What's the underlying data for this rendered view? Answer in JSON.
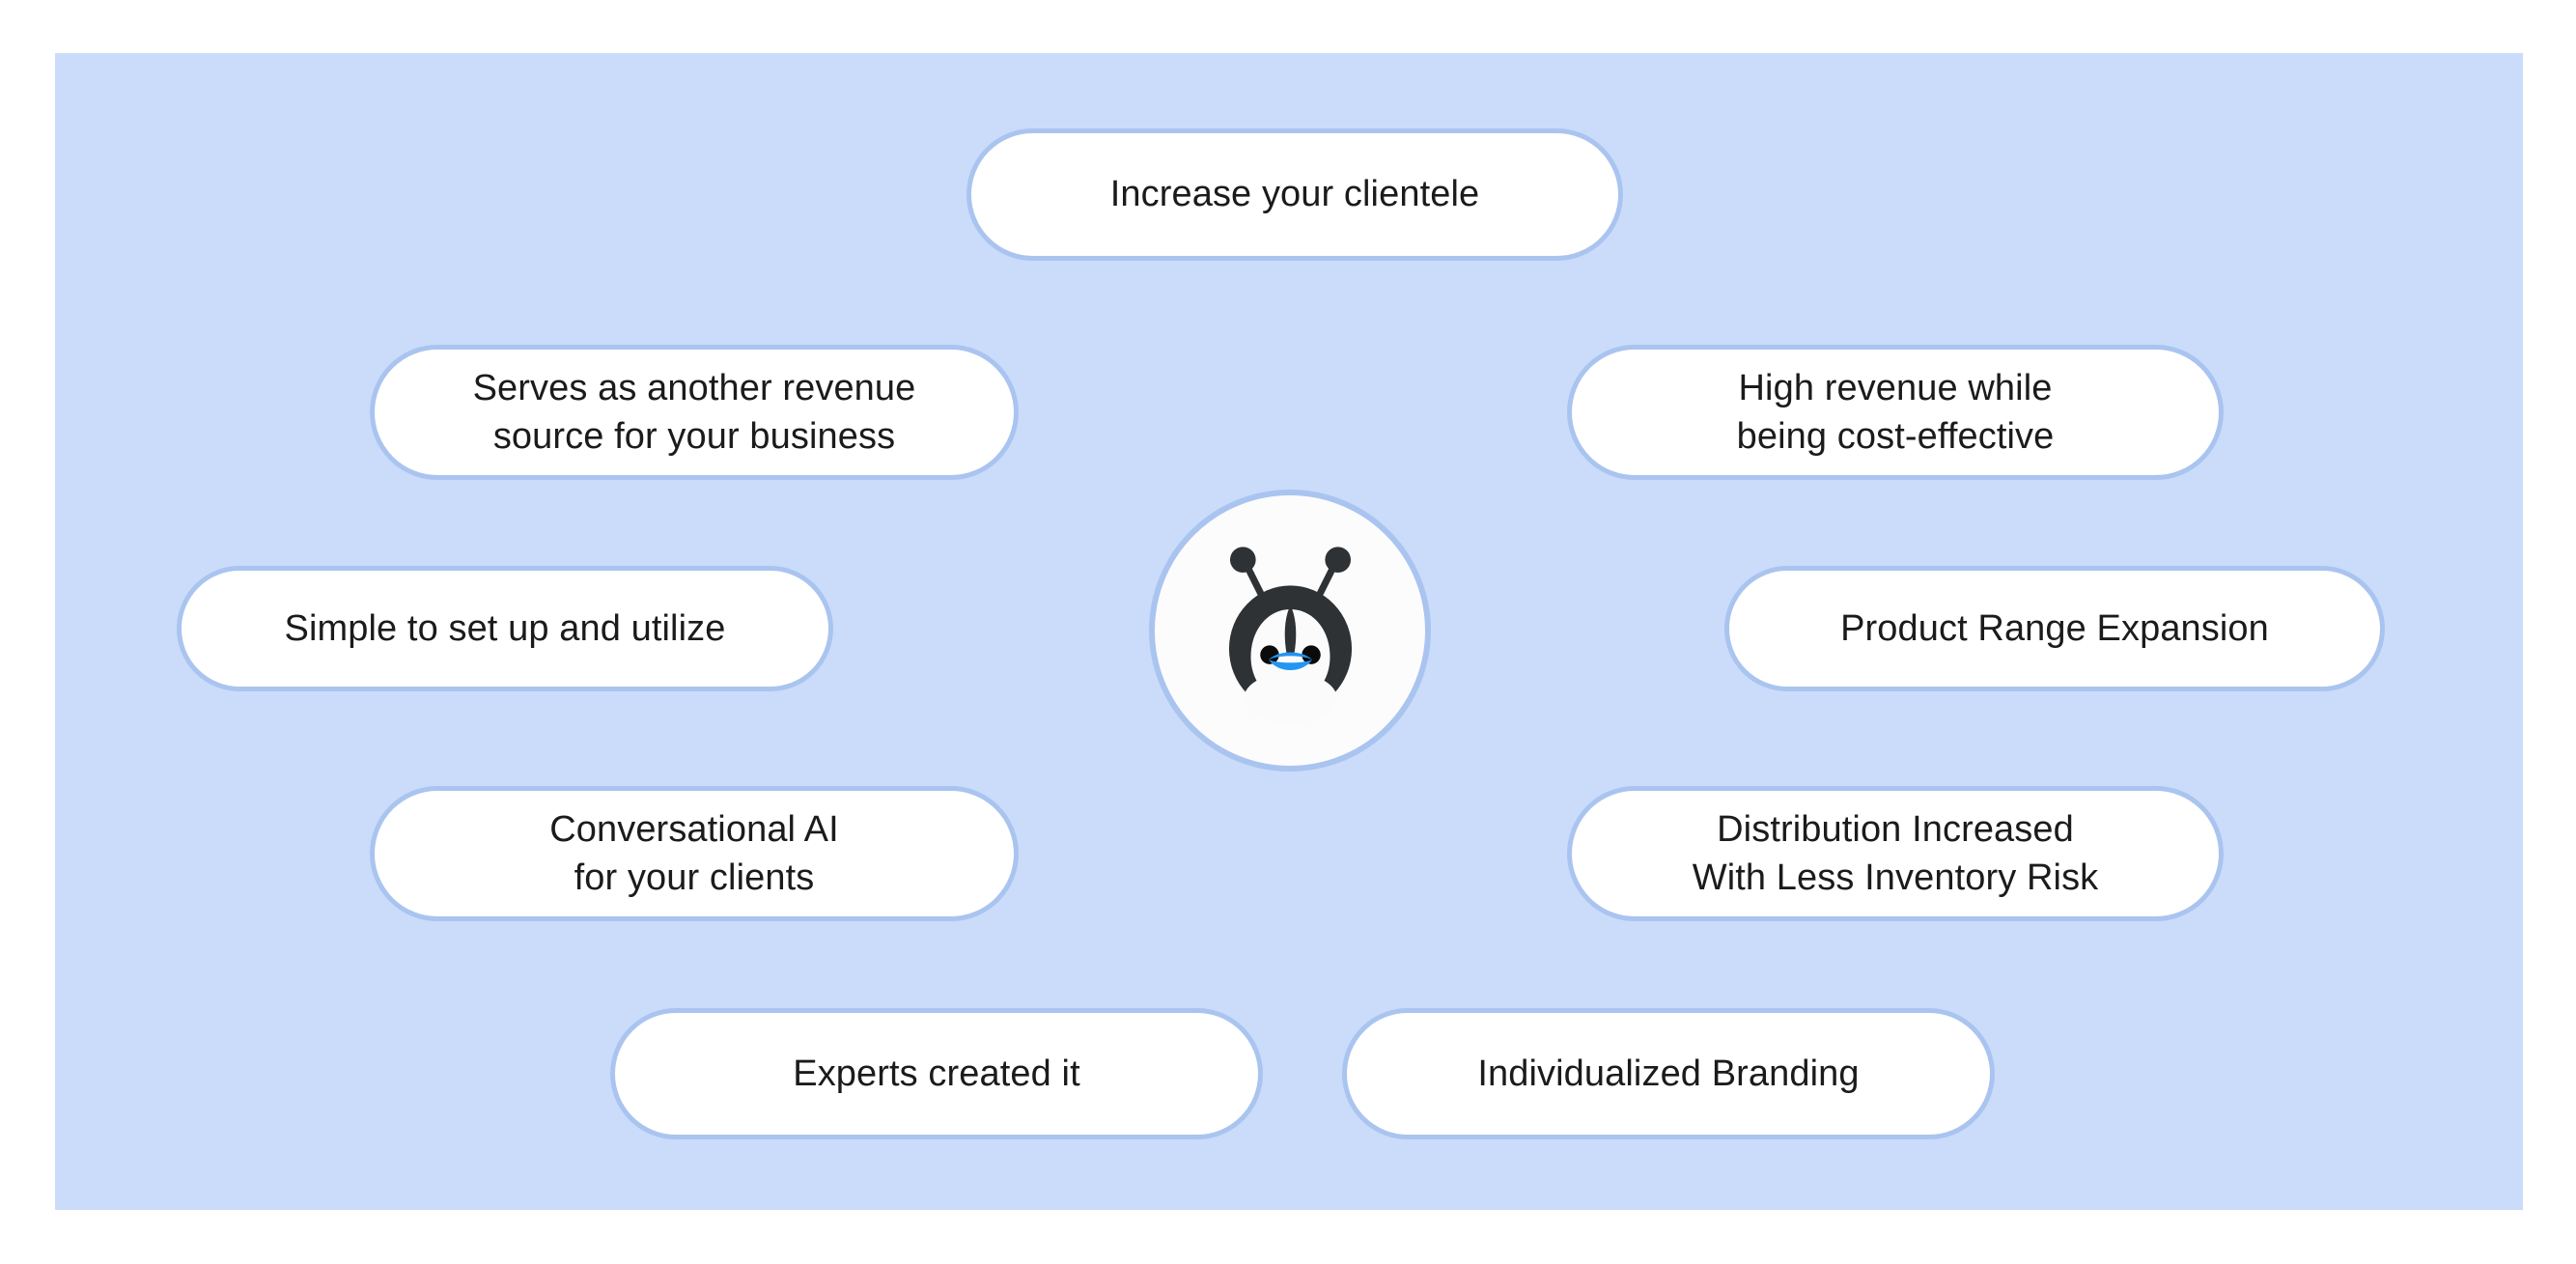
{
  "diagram": {
    "title": "Benefits radial diagram",
    "panel_color": "#cadcfa",
    "pill_fill": "#ffffff",
    "pill_border": "#aac4f0",
    "text_color": "#1b1b1b",
    "mascot": {
      "icon_name": "penguin-bot-mascot-icon",
      "body_color": "#2f3234",
      "face_color": "#fbfbfc",
      "eye_color": "#0b0b0b",
      "beak_color": "#2196f3",
      "badge_fill": "#fcfcfd",
      "badge_border": "#aac4f0"
    },
    "pills": [
      {
        "id": "top",
        "label": "Increase your clientele"
      },
      {
        "id": "left-1",
        "label": "Serves as another revenue\nsource for your business"
      },
      {
        "id": "right-1",
        "label": "High revenue while\nbeing cost-effective"
      },
      {
        "id": "left-2",
        "label": "Simple to set up and utilize"
      },
      {
        "id": "right-2",
        "label": "Product Range Expansion"
      },
      {
        "id": "left-3",
        "label": "Conversational AI\nfor your clients"
      },
      {
        "id": "right-3",
        "label": "Distribution Increased\nWith Less Inventory Risk"
      },
      {
        "id": "bottom-1",
        "label": "Experts created it"
      },
      {
        "id": "bottom-2",
        "label": "Individualized Branding"
      }
    ]
  }
}
